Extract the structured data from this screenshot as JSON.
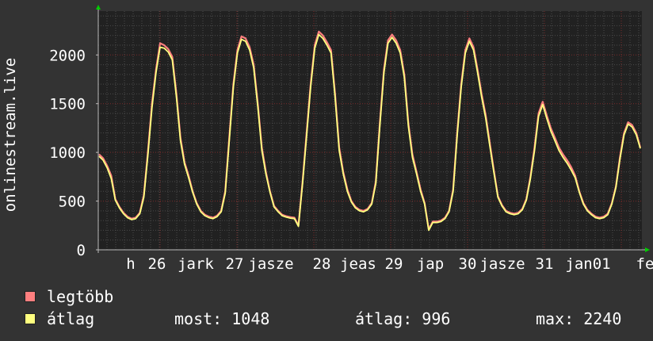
{
  "chart_data": {
    "type": "line",
    "ylabel": "onlinestream.live",
    "ylim": [
      0,
      2450
    ],
    "yticks": [
      0,
      500,
      1000,
      1500,
      2000
    ],
    "grid": true,
    "xtick_labels": [
      "h",
      "26",
      "jark",
      "27",
      "jasze",
      "28",
      "jeas",
      "29",
      "jap",
      "30",
      "jasze",
      "31",
      "jan01",
      "fe"
    ],
    "series": [
      {
        "name": "legtöbb",
        "color": "#ff7f7f",
        "values": [
          980,
          940,
          860,
          760,
          520,
          440,
          380,
          340,
          320,
          330,
          380,
          560,
          1000,
          1500,
          1850,
          2120,
          2100,
          2060,
          1980,
          1600,
          1150,
          900,
          760,
          600,
          480,
          400,
          360,
          340,
          330,
          350,
          400,
          600,
          1150,
          1700,
          2050,
          2190,
          2170,
          2080,
          1900,
          1500,
          1050,
          800,
          600,
          450,
          400,
          360,
          345,
          335,
          330,
          250,
          700,
          1200,
          1700,
          2100,
          2240,
          2200,
          2130,
          2050,
          1600,
          1050,
          800,
          620,
          500,
          440,
          410,
          400,
          420,
          480,
          700,
          1300,
          1850,
          2150,
          2210,
          2150,
          2050,
          1800,
          1300,
          980,
          800,
          620,
          480,
          210,
          290,
          290,
          300,
          330,
          400,
          620,
          1200,
          1700,
          2050,
          2170,
          2080,
          1850,
          1600,
          1380,
          1100,
          820,
          550,
          460,
          400,
          380,
          370,
          380,
          420,
          520,
          750,
          1050,
          1400,
          1520,
          1380,
          1250,
          1150,
          1050,
          980,
          920,
          850,
          760,
          600,
          480,
          410,
          370,
          340,
          330,
          340,
          370,
          480,
          650,
          950,
          1200,
          1310,
          1280,
          1200,
          1050
        ]
      },
      {
        "name": "átlag",
        "color": "#ffff7f",
        "values": [
          960,
          920,
          840,
          730,
          510,
          430,
          370,
          330,
          310,
          320,
          370,
          540,
          970,
          1460,
          1820,
          2080,
          2070,
          2030,
          1950,
          1570,
          1120,
          880,
          740,
          590,
          470,
          390,
          350,
          330,
          320,
          340,
          390,
          580,
          1120,
          1670,
          2020,
          2160,
          2140,
          2050,
          1870,
          1470,
          1020,
          780,
          590,
          440,
          390,
          350,
          335,
          325,
          320,
          240,
          680,
          1170,
          1670,
          2070,
          2210,
          2170,
          2100,
          2020,
          1570,
          1020,
          780,
          600,
          490,
          430,
          400,
          390,
          410,
          470,
          680,
          1270,
          1820,
          2120,
          2180,
          2120,
          2020,
          1770,
          1270,
          950,
          780,
          600,
          470,
          200,
          280,
          280,
          290,
          320,
          390,
          600,
          1170,
          1670,
          2020,
          2140,
          2050,
          1820,
          1570,
          1350,
          1070,
          800,
          540,
          450,
          390,
          370,
          360,
          370,
          410,
          510,
          730,
          1020,
          1370,
          1490,
          1350,
          1220,
          1120,
          1020,
          950,
          890,
          820,
          740,
          590,
          470,
          400,
          360,
          330,
          320,
          330,
          360,
          470,
          640,
          930,
          1180,
          1290,
          1260,
          1180,
          1040
        ]
      }
    ]
  },
  "legend": {
    "max_label": "legtöbb",
    "avg_label": "átlag",
    "now_text": "most: 1048",
    "avg_text": "átlag: 996",
    "max_text": "max: 2240"
  },
  "colors": {
    "background": "#333333",
    "plot_bg": "#212121",
    "grid_major": "#7a2a2a",
    "grid_minor": "#4a4a4a",
    "axis": "#bbbbbb",
    "arrow": "#00cc00"
  }
}
